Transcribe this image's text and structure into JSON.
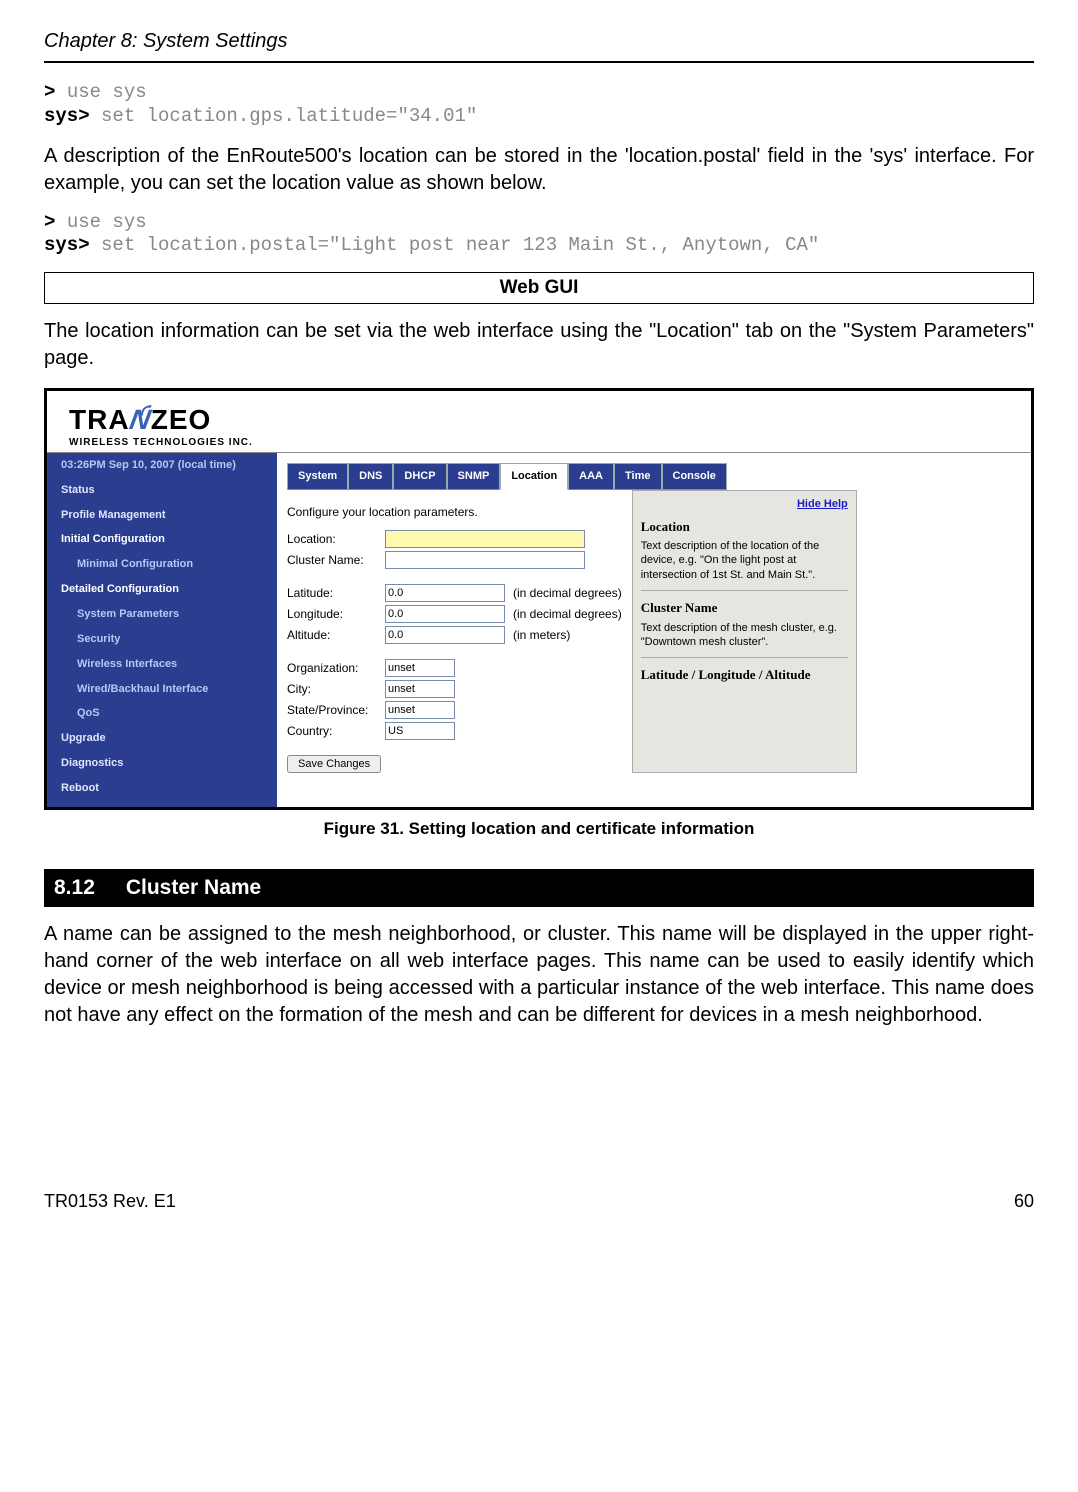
{
  "chapter": "Chapter 8: System Settings",
  "cli1": {
    "gt": ">",
    "use": "use sys",
    "prompt": "sys>",
    "cmd": "set location.gps.latitude=\"34.01\""
  },
  "para1": "A description of the EnRoute500's location can be stored in the 'location.postal' field in the 'sys' interface. For example, you can set the location value as shown below.",
  "cli2": {
    "gt": ">",
    "use": "use sys",
    "prompt": "sys>",
    "cmd": "set location.postal=\"Light post near 123 Main St., Anytown, CA\""
  },
  "webgui": "Web GUI",
  "para2": "The location information can be set via the web interface using the \"Location\" tab on the \"System Parameters\" page.",
  "shot": {
    "brand": {
      "pre": "TRA",
      "n": "N",
      "post": "ZEO",
      "tag": "WIRELESS  TECHNOLOGIES INC."
    },
    "nav": {
      "time": "03:26PM Sep 10, 2007 (local time)",
      "items": [
        "Status",
        "Profile Management"
      ],
      "initial": "Initial Configuration",
      "initial_sub": [
        "Minimal Configuration"
      ],
      "detailed": "Detailed Configuration",
      "detailed_sub": [
        "System Parameters",
        "Security",
        "Wireless Interfaces",
        "Wired/Backhaul Interface",
        "QoS"
      ],
      "bottom": [
        "Upgrade",
        "Diagnostics",
        "Reboot"
      ]
    },
    "tabs": [
      "System",
      "DNS",
      "DHCP",
      "SNMP",
      "Location",
      "AAA",
      "Time",
      "Console"
    ],
    "active_tab": "Location",
    "desc": "Configure your location parameters.",
    "form": {
      "location_label": "Location:",
      "cluster_label": "Cluster Name:",
      "lat_label": "Latitude:",
      "lon_label": "Longitude:",
      "alt_label": "Altitude:",
      "lat_val": "0.0",
      "lon_val": "0.0",
      "alt_val": "0.0",
      "deg_hint": "(in decimal degrees)",
      "m_hint": "(in meters)",
      "org_label": "Organization:",
      "city_label": "City:",
      "state_label": "State/Province:",
      "country_label": "Country:",
      "org_val": "unset",
      "city_val": "unset",
      "state_val": "unset",
      "country_val": "US",
      "save": "Save Changes"
    },
    "help": {
      "hide": "Hide Help",
      "h1": "Location",
      "p1": "Text description of the location of the device, e.g. \"On the light post at intersection of 1st St. and Main St.\".",
      "h2": "Cluster Name",
      "p2": "Text description of the mesh cluster, e.g. \"Downtown mesh cluster\".",
      "h3": "Latitude / Longitude / Altitude"
    }
  },
  "caption": "Figure 31. Setting location and certificate information",
  "section": {
    "num": "8.12",
    "title": "Cluster Name"
  },
  "para3": "A name can be assigned to the mesh neighborhood, or cluster. This name will be displayed in the upper right-hand corner of the web interface on all web interface pages. This name can be used to easily identify which device or mesh neighborhood is being accessed with a particular instance of the web interface. This name does not have any effect on the formation of the mesh and can be different for devices in a mesh neighborhood.",
  "footer": {
    "left": "TR0153 Rev. E1",
    "right": "60"
  }
}
